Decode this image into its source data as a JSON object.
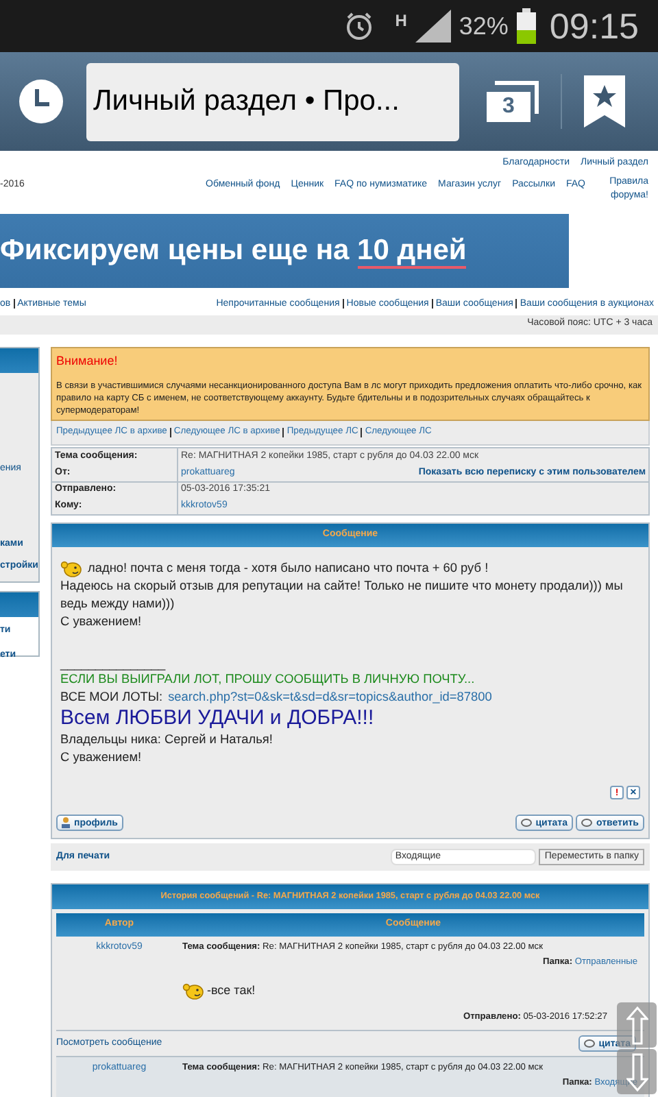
{
  "status_bar": {
    "network": "H",
    "battery_text": "32%",
    "time": "09:15"
  },
  "browser": {
    "url_title": "Личный раздел • Про...",
    "tab_count": "3"
  },
  "header_links": {
    "row1": [
      "Благодарности",
      "Личный раздел"
    ],
    "date_fragment": "-2016",
    "row2": [
      "Обменный фонд",
      "Ценник",
      "FAQ по нумизматике",
      "Магазин услуг",
      "Рассылки",
      "FAQ",
      "Правила форума!"
    ]
  },
  "banner": {
    "text": "Фиксируем цены еще на",
    "highlight": "10 дней"
  },
  "nav": {
    "left": [
      "ов",
      "Активные темы"
    ],
    "right": [
      "Непрочитанные сообщения",
      "Новые сообщения",
      "Ваши сообщения",
      "Ваши сообщения в аукционах"
    ]
  },
  "timezone": "Часовой пояс: UTC + 3 часа",
  "sidebar": {
    "panels": [
      {
        "items": [
          "ения",
          "ками",
          "стройки"
        ]
      },
      {
        "items": [
          "ти",
          "ети"
        ]
      }
    ]
  },
  "warning": {
    "title": "Внимание!",
    "text": "В связи в участившимися случаями несанкционированного доступа Вам в лс могут приходить предложения оплатить что-либо срочно, как правило на карту СБ с именем, не соответствующему аккаунту. Будьте бдительны и в подозрительных случаях обращайтесь к супермодераторам!"
  },
  "pm_nav": [
    "Предыдущее ЛС в архиве",
    "Следующее ЛС в архиве",
    "Предыдущее ЛС",
    "Следующее ЛС"
  ],
  "info": [
    {
      "label": "Тема сообщения:",
      "value": "Re: МАГНИТНАЯ 2 копейки 1985, старт с рубля до 04.03 22.00 мск",
      "kind": "text"
    },
    {
      "label": "От:",
      "value": "prokattuareg",
      "kind": "link",
      "extra": "Показать всю переписку с этим пользователем"
    },
    {
      "label": "Отправлено:",
      "value": "05-03-2016 17:35:21",
      "kind": "text"
    },
    {
      "label": "Кому:",
      "value": "kkkrotov59",
      "kind": "link"
    }
  ],
  "message": {
    "title": "Сообщение",
    "lines": [
      {
        "kind": "smiley",
        "text": "ладно! почта с меня тогда - хотя было написано что почта + 60 руб !"
      },
      {
        "kind": "plain",
        "text": "Надеюсь на скорый отзыв для репутации на сайте! Только не пишите что монету продали))) мы ведь между нами)))"
      },
      {
        "kind": "plain",
        "text": "С уважением!"
      },
      {
        "kind": "rule",
        "text": "_______________"
      },
      {
        "kind": "green",
        "text": "ЕСЛИ ВЫ ВЫИГРАЛИ ЛОТ, ПРОШУ СООБЩИТЬ В ЛИЧНУЮ ПОЧТУ..."
      },
      {
        "kind": "link",
        "text": "ВСЕ МОИ ЛОТЫ:",
        "link": "search.php?st=0&sk=t&sd=d&sr=topics&author_id=87800"
      },
      {
        "kind": "big",
        "text": "Всем ЛЮБВИ УДАЧИ и ДОБРА!!!"
      },
      {
        "kind": "plain",
        "text": "Владельцы ника: Сергей и Наталья!"
      },
      {
        "kind": "plain",
        "text": "С уважением!"
      }
    ],
    "report_icon": "!",
    "delete_icon": "×",
    "buttons": {
      "profile": "профиль",
      "quote": "цитата",
      "reply": "ответить"
    }
  },
  "actions": {
    "print": "Для печати",
    "folder": "Входящие",
    "move": "Переместить в папку"
  },
  "history": {
    "title": "История сообщений - Re: МАГНИТНАЯ 2 копейки 1985, старт с рубля до 04.03 22.00 мск",
    "columns": [
      "Автор",
      "Сообщение"
    ],
    "rows": [
      {
        "author": "kkkrotov59",
        "topic_label": "Тема сообщения:",
        "topic": "Re: МАГНИТНАЯ 2 копейки 1985, старт с рубля до 04.03 22.00 мск",
        "folder_label": "Папка:",
        "folder": "Отправленные",
        "body": "-все так!",
        "sent_label": "Отправлено:",
        "sent": "05-03-2016 17:52:27",
        "view": "Посмотреть сообщение",
        "quote": "цитата"
      },
      {
        "author": "prokattuareg",
        "topic_label": "Тема сообщения:",
        "topic": "Re: МАГНИТНАЯ 2 копейки 1985, старт с рубля до 04.03 22.00 мск",
        "folder_label": "Папка:",
        "folder": "Входящие"
      }
    ]
  }
}
